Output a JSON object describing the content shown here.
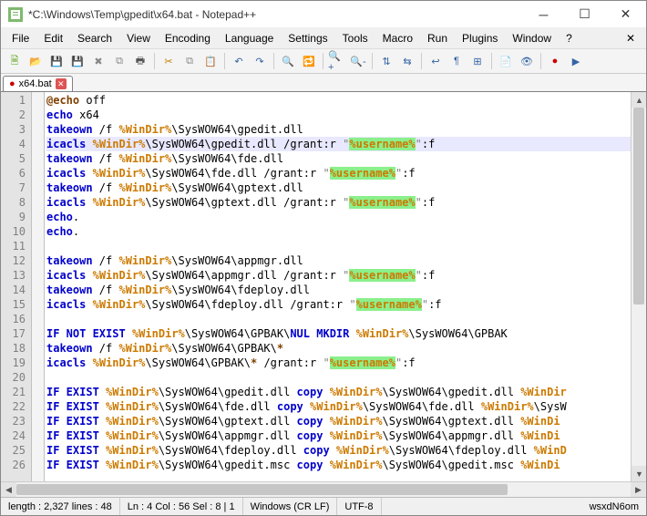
{
  "window": {
    "title": "*C:\\Windows\\Temp\\gpedit\\x64.bat - Notepad++"
  },
  "menu": [
    "File",
    "Edit",
    "Search",
    "View",
    "Encoding",
    "Language",
    "Settings",
    "Tools",
    "Macro",
    "Run",
    "Plugins",
    "Window",
    "?"
  ],
  "toolbar_icons": [
    {
      "name": "new-file-icon",
      "glyph": "🗎",
      "color": "#4e9a06"
    },
    {
      "name": "open-file-icon",
      "glyph": "📂",
      "color": "#c4a000"
    },
    {
      "name": "save-icon",
      "glyph": "💾",
      "color": "#3465a4"
    },
    {
      "name": "save-all-icon",
      "glyph": "💾",
      "color": "#3465a4"
    },
    {
      "name": "close-icon",
      "glyph": "✖",
      "color": "#888"
    },
    {
      "name": "close-all-icon",
      "glyph": "⧉",
      "color": "#888"
    },
    {
      "name": "print-icon",
      "glyph": "🖶",
      "color": "#555"
    },
    "sep",
    {
      "name": "cut-icon",
      "glyph": "✂",
      "color": "#c08000"
    },
    {
      "name": "copy-icon",
      "glyph": "⧉",
      "color": "#888"
    },
    {
      "name": "paste-icon",
      "glyph": "📋",
      "color": "#888"
    },
    "sep",
    {
      "name": "undo-icon",
      "glyph": "↶",
      "color": "#3465a4"
    },
    {
      "name": "redo-icon",
      "glyph": "↷",
      "color": "#3465a4"
    },
    "sep",
    {
      "name": "find-icon",
      "glyph": "🔍",
      "color": "#555"
    },
    {
      "name": "replace-icon",
      "glyph": "🔁",
      "color": "#555"
    },
    "sep",
    {
      "name": "zoom-in-icon",
      "glyph": "🔍+",
      "color": "#3465a4"
    },
    {
      "name": "zoom-out-icon",
      "glyph": "🔍-",
      "color": "#3465a4"
    },
    "sep",
    {
      "name": "sync-v-icon",
      "glyph": "⇅",
      "color": "#3465a4"
    },
    {
      "name": "sync-h-icon",
      "glyph": "⇆",
      "color": "#3465a4"
    },
    "sep",
    {
      "name": "wrap-icon",
      "glyph": "↩",
      "color": "#3465a4"
    },
    {
      "name": "allchars-icon",
      "glyph": "¶",
      "color": "#3465a4"
    },
    {
      "name": "indent-guide-icon",
      "glyph": "⊞",
      "color": "#3465a4"
    },
    "sep",
    {
      "name": "lang-icon",
      "glyph": "📄",
      "color": "#3465a4"
    },
    {
      "name": "monitor-icon",
      "glyph": "👁",
      "color": "#3465a4"
    },
    "sep",
    {
      "name": "record-icon",
      "glyph": "●",
      "color": "#cc0000"
    },
    {
      "name": "play-icon",
      "glyph": "▶",
      "color": "#3465a4"
    }
  ],
  "tab": {
    "label": "x64.bat",
    "unsaved_marker": "●"
  },
  "code": {
    "lines": [
      [
        {
          "t": "@echo",
          "c": "op"
        },
        {
          "t": " off",
          "c": ""
        }
      ],
      [
        {
          "t": "echo",
          "c": "kw"
        },
        {
          "t": " x64",
          "c": ""
        }
      ],
      [
        {
          "t": "takeown",
          "c": "kw"
        },
        {
          "t": " /f ",
          "c": ""
        },
        {
          "t": "%WinDir%",
          "c": "var"
        },
        {
          "t": "\\SysWOW64\\gpedit.dll",
          "c": ""
        }
      ],
      [
        {
          "t": "icacls",
          "c": "kw"
        },
        {
          "t": " ",
          "c": ""
        },
        {
          "t": "%WinDir%",
          "c": "var"
        },
        {
          "t": "\\SysWOW64\\gpedit.dll /grant:r ",
          "c": ""
        },
        {
          "t": "\"",
          "c": "str"
        },
        {
          "t": "%username%",
          "c": "var hl"
        },
        {
          "t": "\"",
          "c": "str"
        },
        {
          "t": ":f",
          "c": ""
        }
      ],
      [
        {
          "t": "takeown",
          "c": "kw"
        },
        {
          "t": " /f ",
          "c": ""
        },
        {
          "t": "%WinDir%",
          "c": "var"
        },
        {
          "t": "\\SysWOW64\\fde.dll",
          "c": ""
        }
      ],
      [
        {
          "t": "icacls",
          "c": "kw"
        },
        {
          "t": " ",
          "c": ""
        },
        {
          "t": "%WinDir%",
          "c": "var"
        },
        {
          "t": "\\SysWOW64\\fde.dll /grant:r ",
          "c": ""
        },
        {
          "t": "\"",
          "c": "str"
        },
        {
          "t": "%username%",
          "c": "var hl"
        },
        {
          "t": "\"",
          "c": "str"
        },
        {
          "t": ":f",
          "c": ""
        }
      ],
      [
        {
          "t": "takeown",
          "c": "kw"
        },
        {
          "t": " /f ",
          "c": ""
        },
        {
          "t": "%WinDir%",
          "c": "var"
        },
        {
          "t": "\\SysWOW64\\gptext.dll",
          "c": ""
        }
      ],
      [
        {
          "t": "icacls",
          "c": "kw"
        },
        {
          "t": " ",
          "c": ""
        },
        {
          "t": "%WinDir%",
          "c": "var"
        },
        {
          "t": "\\SysWOW64\\gptext.dll /grant:r ",
          "c": ""
        },
        {
          "t": "\"",
          "c": "str"
        },
        {
          "t": "%username%",
          "c": "var hl"
        },
        {
          "t": "\"",
          "c": "str"
        },
        {
          "t": ":f",
          "c": ""
        }
      ],
      [
        {
          "t": "echo",
          "c": "kw"
        },
        {
          "t": ".",
          "c": ""
        }
      ],
      [
        {
          "t": "echo",
          "c": "kw"
        },
        {
          "t": ".",
          "c": ""
        }
      ],
      [],
      [
        {
          "t": "takeown",
          "c": "kw"
        },
        {
          "t": " /f ",
          "c": ""
        },
        {
          "t": "%WinDir%",
          "c": "var"
        },
        {
          "t": "\\SysWOW64\\appmgr.dll",
          "c": ""
        }
      ],
      [
        {
          "t": "icacls",
          "c": "kw"
        },
        {
          "t": " ",
          "c": ""
        },
        {
          "t": "%WinDir%",
          "c": "var"
        },
        {
          "t": "\\SysWOW64\\appmgr.dll /grant:r ",
          "c": ""
        },
        {
          "t": "\"",
          "c": "str"
        },
        {
          "t": "%username%",
          "c": "var hl"
        },
        {
          "t": "\"",
          "c": "str"
        },
        {
          "t": ":f",
          "c": ""
        }
      ],
      [
        {
          "t": "takeown",
          "c": "kw"
        },
        {
          "t": " /f ",
          "c": ""
        },
        {
          "t": "%WinDir%",
          "c": "var"
        },
        {
          "t": "\\SysWOW64\\fdeploy.dll",
          "c": ""
        }
      ],
      [
        {
          "t": "icacls",
          "c": "kw"
        },
        {
          "t": " ",
          "c": ""
        },
        {
          "t": "%WinDir%",
          "c": "var"
        },
        {
          "t": "\\SysWOW64\\fdeploy.dll /grant:r ",
          "c": ""
        },
        {
          "t": "\"",
          "c": "str"
        },
        {
          "t": "%username%",
          "c": "var hl"
        },
        {
          "t": "\"",
          "c": "str"
        },
        {
          "t": ":f",
          "c": ""
        }
      ],
      [],
      [
        {
          "t": "IF NOT EXIST",
          "c": "kw"
        },
        {
          "t": " ",
          "c": ""
        },
        {
          "t": "%WinDir%",
          "c": "var"
        },
        {
          "t": "\\SysWOW64\\GPBAK\\",
          "c": ""
        },
        {
          "t": "NUL",
          "c": "kw"
        },
        {
          "t": " ",
          "c": ""
        },
        {
          "t": "MKDIR",
          "c": "kw"
        },
        {
          "t": " ",
          "c": ""
        },
        {
          "t": "%WinDir%",
          "c": "var"
        },
        {
          "t": "\\SysWOW64\\GPBAK",
          "c": ""
        }
      ],
      [
        {
          "t": "takeown",
          "c": "kw"
        },
        {
          "t": " /f ",
          "c": ""
        },
        {
          "t": "%WinDir%",
          "c": "var"
        },
        {
          "t": "\\SysWOW64\\GPBAK\\",
          "c": ""
        },
        {
          "t": "*",
          "c": "op"
        }
      ],
      [
        {
          "t": "icacls",
          "c": "kw"
        },
        {
          "t": " ",
          "c": ""
        },
        {
          "t": "%WinDir%",
          "c": "var"
        },
        {
          "t": "\\SysWOW64\\GPBAK\\",
          "c": ""
        },
        {
          "t": "*",
          "c": "op"
        },
        {
          "t": " /grant:r ",
          "c": ""
        },
        {
          "t": "\"",
          "c": "str"
        },
        {
          "t": "%username%",
          "c": "var hl"
        },
        {
          "t": "\"",
          "c": "str"
        },
        {
          "t": ":f",
          "c": ""
        }
      ],
      [],
      [
        {
          "t": "IF EXIST",
          "c": "kw"
        },
        {
          "t": " ",
          "c": ""
        },
        {
          "t": "%WinDir%",
          "c": "var"
        },
        {
          "t": "\\SysWOW64\\gpedit.dll ",
          "c": ""
        },
        {
          "t": "copy",
          "c": "kw"
        },
        {
          "t": " ",
          "c": ""
        },
        {
          "t": "%WinDir%",
          "c": "var"
        },
        {
          "t": "\\SysWOW64\\gpedit.dll ",
          "c": ""
        },
        {
          "t": "%WinDir",
          "c": "var"
        }
      ],
      [
        {
          "t": "IF EXIST",
          "c": "kw"
        },
        {
          "t": " ",
          "c": ""
        },
        {
          "t": "%WinDir%",
          "c": "var"
        },
        {
          "t": "\\SysWOW64\\fde.dll ",
          "c": ""
        },
        {
          "t": "copy",
          "c": "kw"
        },
        {
          "t": " ",
          "c": ""
        },
        {
          "t": "%WinDir%",
          "c": "var"
        },
        {
          "t": "\\SysWOW64\\fde.dll ",
          "c": ""
        },
        {
          "t": "%WinDir%",
          "c": "var"
        },
        {
          "t": "\\SysW",
          "c": ""
        }
      ],
      [
        {
          "t": "IF EXIST",
          "c": "kw"
        },
        {
          "t": " ",
          "c": ""
        },
        {
          "t": "%WinDir%",
          "c": "var"
        },
        {
          "t": "\\SysWOW64\\gptext.dll ",
          "c": ""
        },
        {
          "t": "copy",
          "c": "kw"
        },
        {
          "t": " ",
          "c": ""
        },
        {
          "t": "%WinDir%",
          "c": "var"
        },
        {
          "t": "\\SysWOW64\\gptext.dll ",
          "c": ""
        },
        {
          "t": "%WinDi",
          "c": "var"
        }
      ],
      [
        {
          "t": "IF EXIST",
          "c": "kw"
        },
        {
          "t": " ",
          "c": ""
        },
        {
          "t": "%WinDir%",
          "c": "var"
        },
        {
          "t": "\\SysWOW64\\appmgr.dll ",
          "c": ""
        },
        {
          "t": "copy",
          "c": "kw"
        },
        {
          "t": " ",
          "c": ""
        },
        {
          "t": "%WinDir%",
          "c": "var"
        },
        {
          "t": "\\SysWOW64\\appmgr.dll ",
          "c": ""
        },
        {
          "t": "%WinDi",
          "c": "var"
        }
      ],
      [
        {
          "t": "IF EXIST",
          "c": "kw"
        },
        {
          "t": " ",
          "c": ""
        },
        {
          "t": "%WinDir%",
          "c": "var"
        },
        {
          "t": "\\SysWOW64\\fdeploy.dll ",
          "c": ""
        },
        {
          "t": "copy",
          "c": "kw"
        },
        {
          "t": " ",
          "c": ""
        },
        {
          "t": "%WinDir%",
          "c": "var"
        },
        {
          "t": "\\SysWOW64\\fdeploy.dll ",
          "c": ""
        },
        {
          "t": "%WinD",
          "c": "var"
        }
      ],
      [
        {
          "t": "IF EXIST",
          "c": "kw"
        },
        {
          "t": " ",
          "c": ""
        },
        {
          "t": "%WinDir%",
          "c": "var"
        },
        {
          "t": "\\SysWOW64\\gpedit.msc ",
          "c": ""
        },
        {
          "t": "copy",
          "c": "kw"
        },
        {
          "t": " ",
          "c": ""
        },
        {
          "t": "%WinDir%",
          "c": "var"
        },
        {
          "t": "\\SysWOW64\\gpedit.msc ",
          "c": ""
        },
        {
          "t": "%WinDi",
          "c": "var"
        }
      ]
    ],
    "current_line": 4
  },
  "status": {
    "length": "length : 2,327    lines : 48",
    "pos": "Ln : 4    Col : 56    Sel : 8 | 1",
    "eol": "Windows (CR LF)",
    "enc": "UTF-8",
    "watermark": "wsxdN6om"
  }
}
